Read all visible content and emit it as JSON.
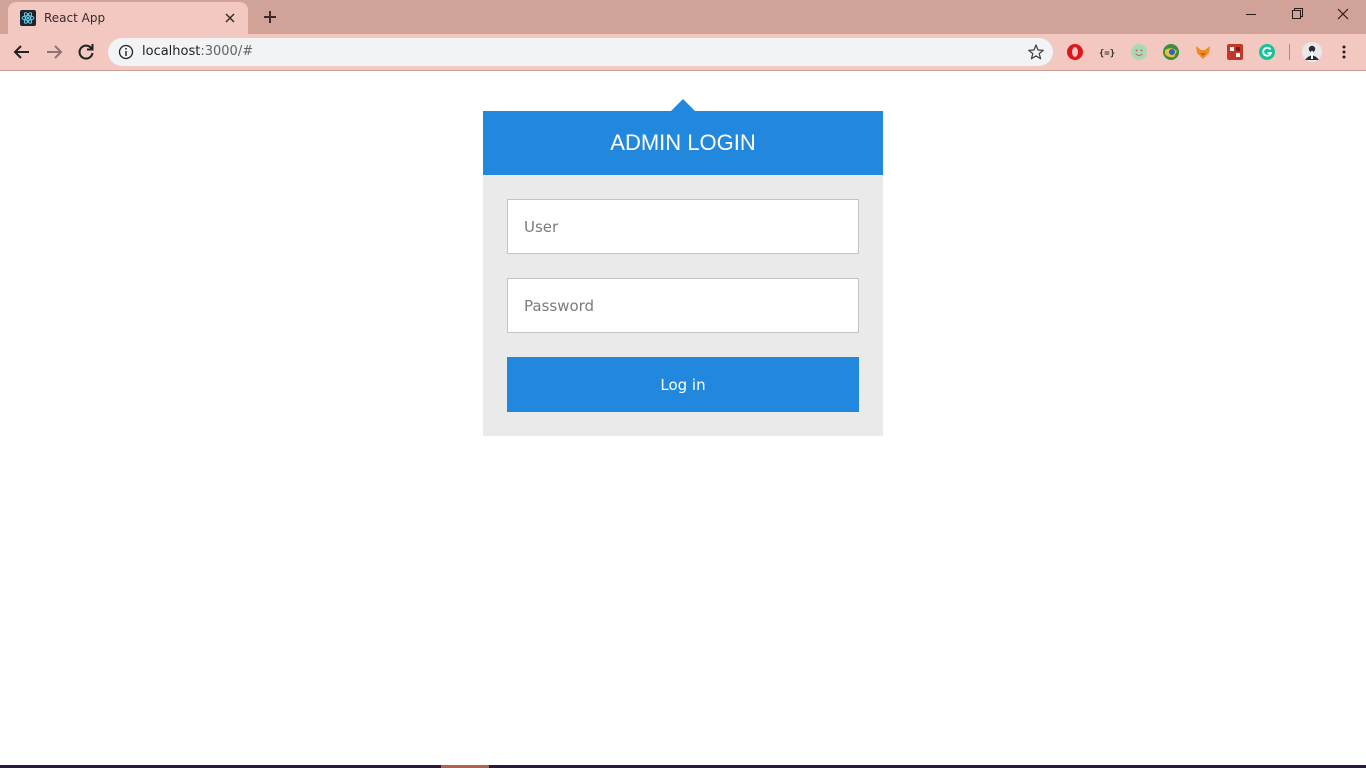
{
  "browser": {
    "tab_title": "React App",
    "url_host": "localhost",
    "url_rest": ":3000/#",
    "icons": {
      "tab_favicon": "react-icon",
      "close_tab": "close-icon",
      "new_tab": "plus-icon",
      "back": "arrow-left-icon",
      "forward": "arrow-right-icon",
      "reload": "reload-icon",
      "site_info": "info-icon",
      "bookmark": "star-icon",
      "menu": "kebab-menu-icon"
    },
    "extensions": [
      "opera-icon",
      "json-icon",
      "face-icon",
      "globe-icon",
      "fox-icon",
      "puzzle-icon",
      "grammarly-icon",
      "avatar"
    ]
  },
  "login": {
    "title": "ADMIN LOGIN",
    "user_placeholder": "User",
    "password_placeholder": "Password",
    "submit_label": "Log in"
  },
  "colors": {
    "accent": "#2288dd",
    "panel": "#eaeaea",
    "chrome": "#f2c8c0"
  }
}
